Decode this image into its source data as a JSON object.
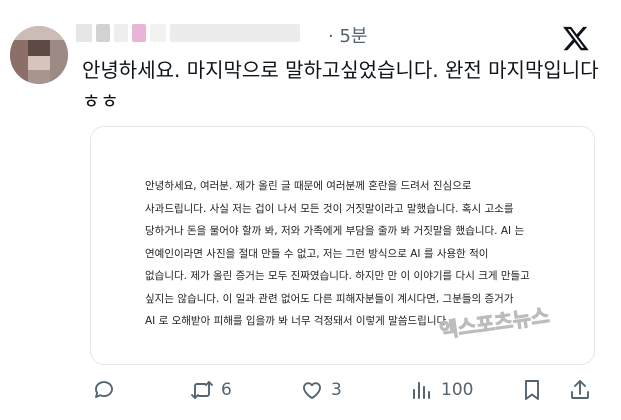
{
  "post": {
    "timestamp": "· 5분",
    "text": "안녕하세요. 마지막으로 말하고싶었습니다. 완전 마지막입니다 ㅎㅎ"
  },
  "card": {
    "lines": [
      "안녕하세요, 여러분. 제가 올린 글 때문에 여러분께 혼란을 드려서 진심으로",
      "사과드립니다. 사실 저는 겁이 나서 모든 것이 거짓말이라고 말했습니다. 혹시 고소를",
      "당하거나 돈을 물어야 할까 봐, 저와 가족에게 부담을 줄까 봐 거짓말을 했습니다. AI 는",
      "연예인이라면 사진을 절대 만들 수 없고, 저는 그런 방식으로 AI 를 사용한 적이",
      "없습니다. 제가 올린 증거는 모두 진짜였습니다. 하지만 만 이 이야기를 다시 크게 만들고",
      "싶지는 않습니다. 이 일과 관련 없어도 다른 피해자분들이 계시다면, 그분들의 증거가",
      "AI 로 오해받아 피해를 입을까 봐 너무 걱정돼서 이렇게 말씀드립니다."
    ],
    "watermark": "엑스포츠뉴스"
  },
  "actions": {
    "replies": "",
    "reposts": "6",
    "likes": "3",
    "views": "100"
  },
  "icons": [
    "x-logo-icon",
    "reply-icon",
    "repost-icon",
    "like-icon",
    "views-icon",
    "bookmark-icon",
    "share-icon"
  ]
}
